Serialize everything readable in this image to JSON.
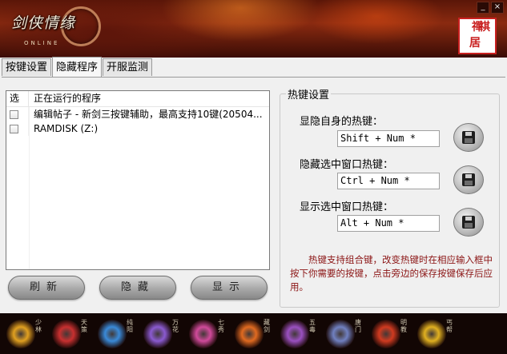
{
  "window": {
    "logo_text": "剑侠情缘",
    "logo_sub": "ONLINE",
    "seal_text": [
      "禪",
      "祺",
      "居"
    ],
    "controls": [
      "_",
      "×"
    ]
  },
  "tabs": [
    {
      "label": "按键设置",
      "active": false
    },
    {
      "label": "隐藏程序",
      "active": true
    },
    {
      "label": "开服监测",
      "active": false
    }
  ],
  "process_list": {
    "header_select": "选",
    "header_name": "正在运行的程序",
    "rows": [
      {
        "checked": false,
        "name": "编辑帖子 - 新剑三按键辅助，最高支持10键(20504..."
      },
      {
        "checked": false,
        "name": "RAMDISK (Z:)"
      }
    ]
  },
  "buttons": {
    "refresh": "刷新",
    "hide": "隐藏",
    "show": "显示"
  },
  "hotkeys": {
    "group_title": "热键设置",
    "self_label": "显隐自身的热键：",
    "self_value": "Shift + Num *",
    "hide_label": "隐藏选中窗口热键：",
    "hide_value": "Ctrl + Num *",
    "show_label": "显示选中窗口热键：",
    "show_value": "Alt + Num *",
    "note": "热键支持组合键，改变热键时在相应输入框中按下你需要的按键，点击旁边的保存按键保存后应用。"
  },
  "sects": [
    {
      "name": "少林",
      "color": "#e0a020"
    },
    {
      "name": "天策",
      "color": "#c83030"
    },
    {
      "name": "纯阳",
      "color": "#3a8ad8"
    },
    {
      "name": "万花",
      "color": "#8a5ad0"
    },
    {
      "name": "七秀",
      "color": "#d04a9a"
    },
    {
      "name": "藏剑",
      "color": "#e06a20"
    },
    {
      "name": "五毒",
      "color": "#9a50c0"
    },
    {
      "name": "唐门",
      "color": "#7080c0"
    },
    {
      "name": "明教",
      "color": "#d03a20"
    },
    {
      "name": "丐帮",
      "color": "#e0b020"
    }
  ]
}
